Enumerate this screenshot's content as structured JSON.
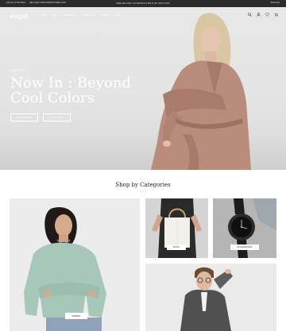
{
  "topbar": {
    "phone": "+020 (0) 17 654 3512",
    "email": "HELLO@YOURCOMPANYNAME.COM",
    "promo": "FREE DELIVERY ON ORDERS OVER $ 150. DON'T MISS",
    "language": "ENGLISH"
  },
  "nav": {
    "logo": "vogal",
    "menu": [
      "HOME",
      "SHOP",
      "PRODUCTS",
      "ELEMENTS",
      "PAGES",
      "BLOG"
    ]
  },
  "hero": {
    "eyebrow": "SINCE 2017",
    "headline": "Now In : Beyond Cool Colors",
    "buttons": [
      "SHOP WOMEN",
      "SHOP MEN"
    ]
  },
  "categories": {
    "title": "Shop by Categories",
    "dots": "• • •",
    "items": [
      {
        "label": "WOMEN"
      },
      {
        "label": "BAGS"
      },
      {
        "label": "ACCESSORIES"
      }
    ]
  },
  "colors": {
    "topbar": "#2b2b2b",
    "coat": "#b98c7c",
    "accent": "#e08a5a",
    "sweater": "#a8c7bb"
  }
}
